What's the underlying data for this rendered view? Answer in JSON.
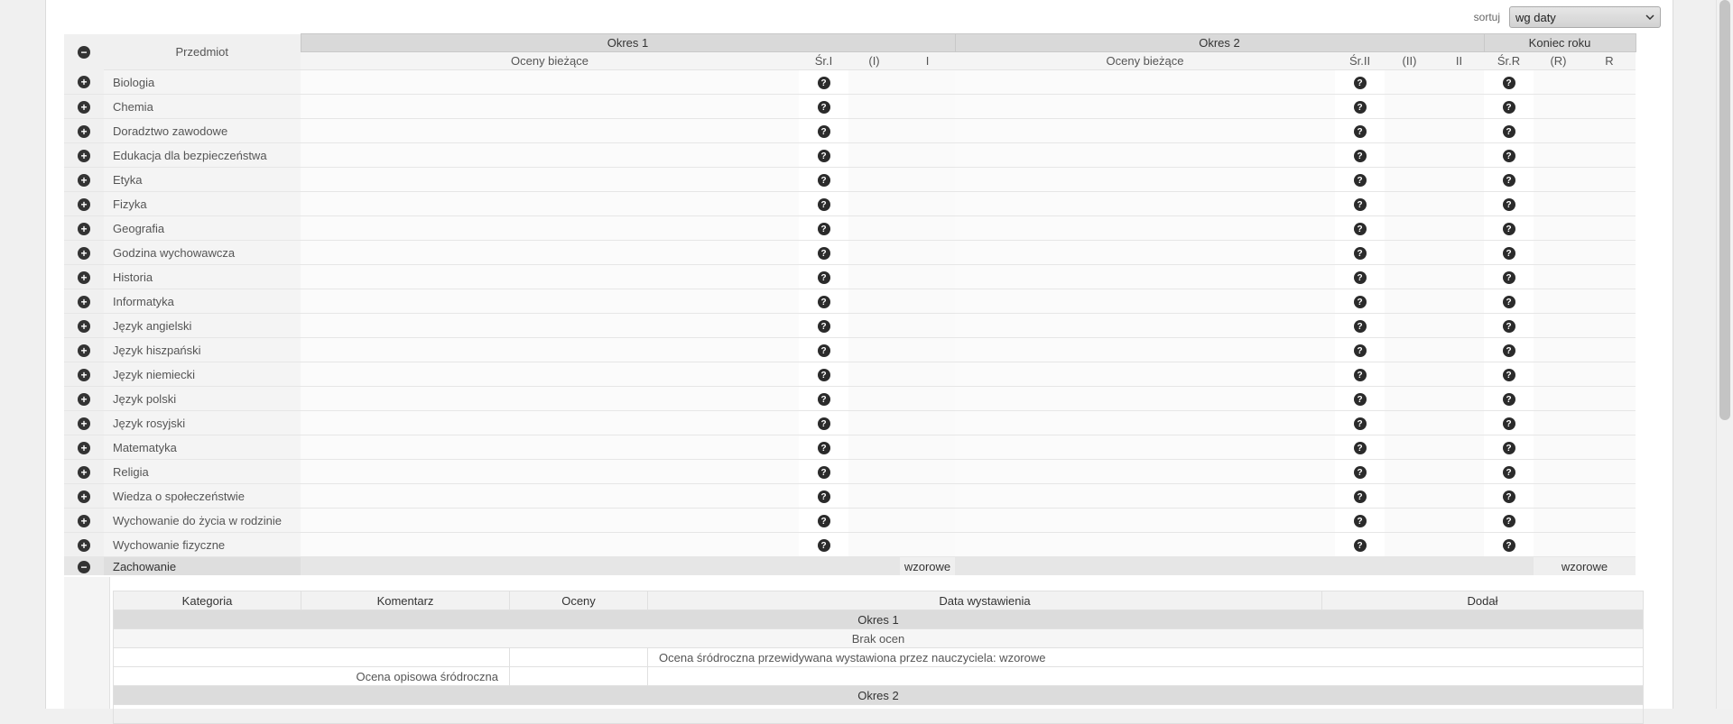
{
  "sort": {
    "label": "sortuj",
    "value": "wg daty"
  },
  "headers": {
    "subject": "Przedmiot",
    "period1": "Okres 1",
    "period2": "Okres 2",
    "year_end": "Koniec roku",
    "current_grades": "Oceny bieżące",
    "avg1": "Śr.I",
    "proposed1": "(I)",
    "final1": "I",
    "avg2": "Śr.II",
    "proposed2": "(II)",
    "final2": "II",
    "avgR": "Śr.R",
    "proposedR": "(R)",
    "finalR": "R"
  },
  "subjects": [
    "Biologia",
    "Chemia",
    "Doradztwo zawodowe",
    "Edukacja dla bezpieczeństwa",
    "Etyka",
    "Fizyka",
    "Geografia",
    "Godzina wychowawcza",
    "Historia",
    "Informatyka",
    "Język angielski",
    "Język hiszpański",
    "Język niemiecki",
    "Język polski",
    "Język rosyjski",
    "Matematyka",
    "Religia",
    "Wiedza o społeczeństwie",
    "Wychowanie do życia w rodzinie",
    "Wychowanie fizyczne"
  ],
  "behavior": {
    "label": "Zachowanie",
    "final1": "wzorowe",
    "finalR": "wzorowe"
  },
  "detail": {
    "headers": [
      "Kategoria",
      "Komentarz",
      "Oceny",
      "Data wystawienia",
      "Dodał"
    ],
    "period1": "Okres 1",
    "no_grades": "Brak ocen",
    "predicted_note": "Ocena śródroczna przewidywana wystawiona przez nauczyciela: wzorowe",
    "descriptive": "Ocena opisowa śródroczna",
    "period2": "Okres 2"
  },
  "icons": {
    "expand": "plus-circle-icon",
    "collapse": "minus-circle-icon",
    "help": "question-circle-icon"
  }
}
